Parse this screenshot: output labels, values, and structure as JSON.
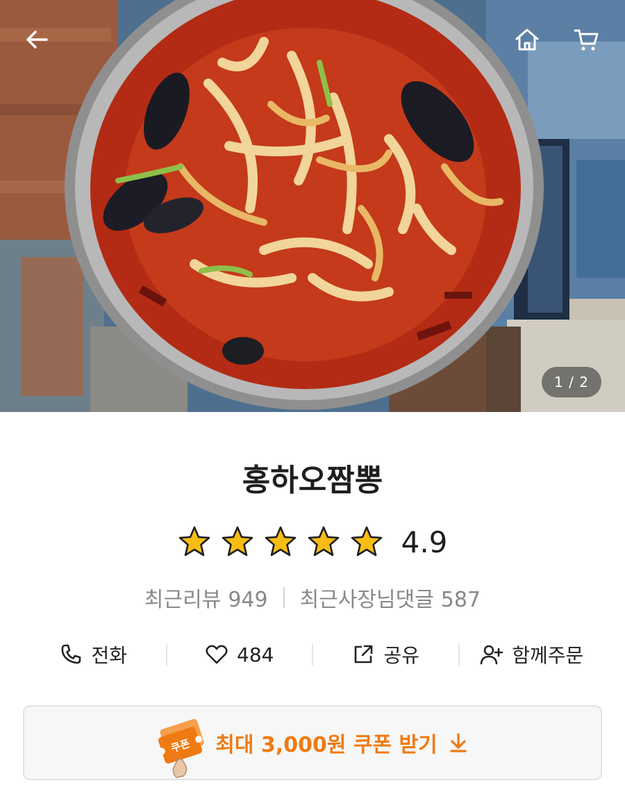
{
  "hero": {
    "page_indicator": "1 / 2"
  },
  "store": {
    "name": "홍하오짬뽕",
    "rating": 4.9,
    "rating_text": "4.9",
    "stars": 5
  },
  "reviews": {
    "recent_reviews_label": "최근리뷰",
    "recent_reviews_count": "949",
    "owner_replies_label": "최근사장님댓글",
    "owner_replies_count": "587"
  },
  "actions": {
    "call_label": "전화",
    "like_count": "484",
    "share_label": "공유",
    "group_order_label": "함께주문"
  },
  "coupon": {
    "label": "최대 3,000원 쿠폰 받기",
    "badge_text": "쿠폰",
    "accent_color": "#f07a12"
  },
  "icons": [
    "back-arrow-icon",
    "home-icon",
    "cart-icon",
    "star-icon",
    "phone-icon",
    "heart-icon",
    "share-icon",
    "add-person-icon",
    "coupon-icon",
    "download-arrow-icon"
  ]
}
